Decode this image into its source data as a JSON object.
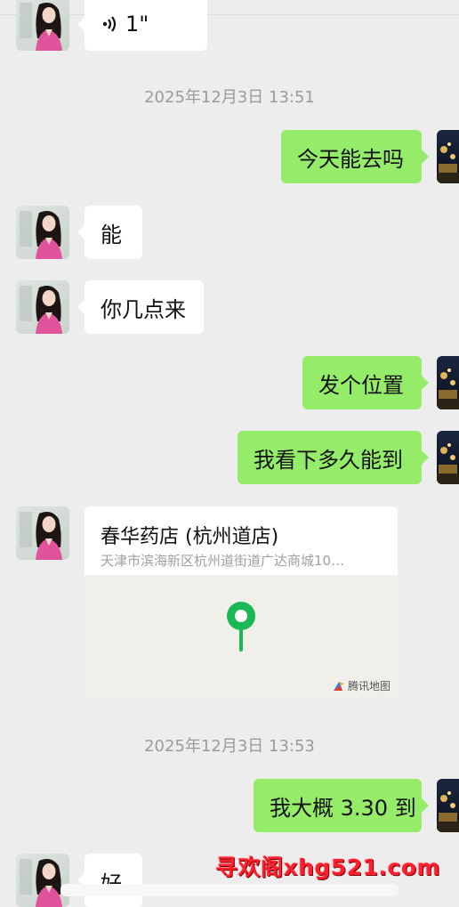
{
  "messages": {
    "voice_duration": "1\"",
    "timestamp_1": "2025年12月3日 13:51",
    "out_1": "今天能去吗",
    "in_1": "能",
    "in_2": "你几点来",
    "out_2": "发个位置",
    "out_3": "我看下多久能到",
    "location": {
      "title": "春华药店 (杭州道店)",
      "address": "天津市滨海新区杭州道街道广达商城10…",
      "map_brand": "腾讯地图"
    },
    "timestamp_2": "2025年12月3日 13:53",
    "out_4": "我大概 3.30 到",
    "in_3": "好"
  },
  "watermark": "寻欢阁xhg521.com",
  "colors": {
    "background": "#ededed",
    "incoming_bubble": "#ffffff",
    "outgoing_bubble": "#95ec69",
    "map_pin": "#19b955",
    "watermark": "#ff1f2e"
  },
  "icons": {
    "voice": "voice-wave-icon",
    "map_pin": "map-pin-icon",
    "map_logo": "tencent-map-logo-icon"
  }
}
